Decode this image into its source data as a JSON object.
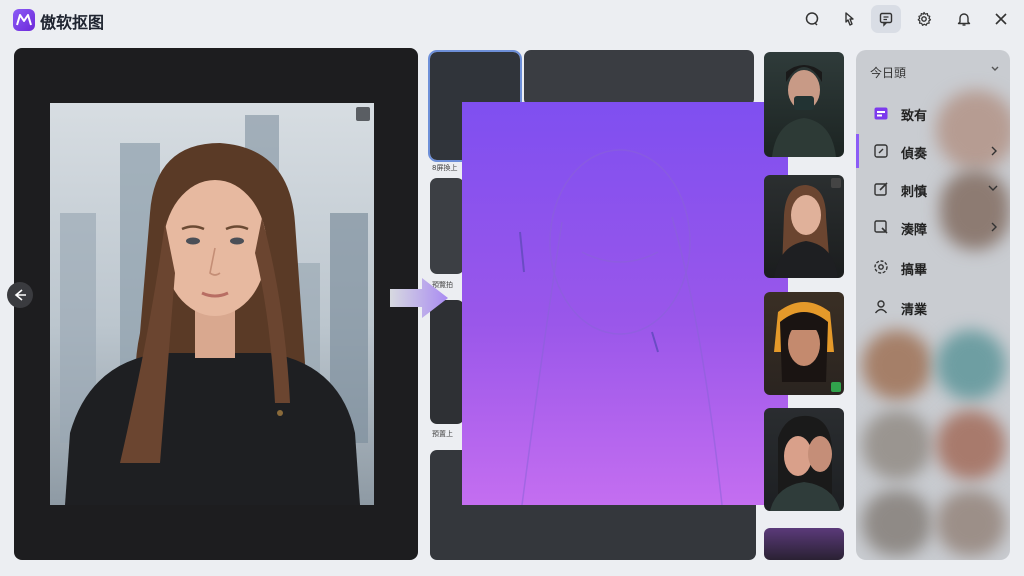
{
  "app": {
    "title": "傲软抠图"
  },
  "toolbar": {
    "buttons": [
      {
        "name": "chat-icon"
      },
      {
        "name": "pointer-icon"
      },
      {
        "name": "feedback-icon",
        "active": true
      },
      {
        "name": "settings-icon"
      },
      {
        "name": "bell-icon"
      },
      {
        "name": "close-icon"
      }
    ]
  },
  "menu": {
    "header": "今日頭",
    "items": [
      {
        "label": "致有",
        "icon": "calendar-icon"
      },
      {
        "label": "偵奏",
        "icon": "edit-box-icon"
      },
      {
        "label": "刺慎",
        "icon": "pen-square-icon"
      },
      {
        "label": "湊障",
        "icon": "crop-icon"
      },
      {
        "label": "搞畢",
        "icon": "gear-icon"
      },
      {
        "label": "清業",
        "icon": "user-icon"
      }
    ]
  },
  "gallery": {
    "captions": [
      "8屏換上",
      "預覽拍",
      "預置上"
    ]
  },
  "colors": {
    "accent": "#8b5cf6",
    "result_top": "#7f4ff0",
    "result_bottom": "#c46ef0"
  }
}
